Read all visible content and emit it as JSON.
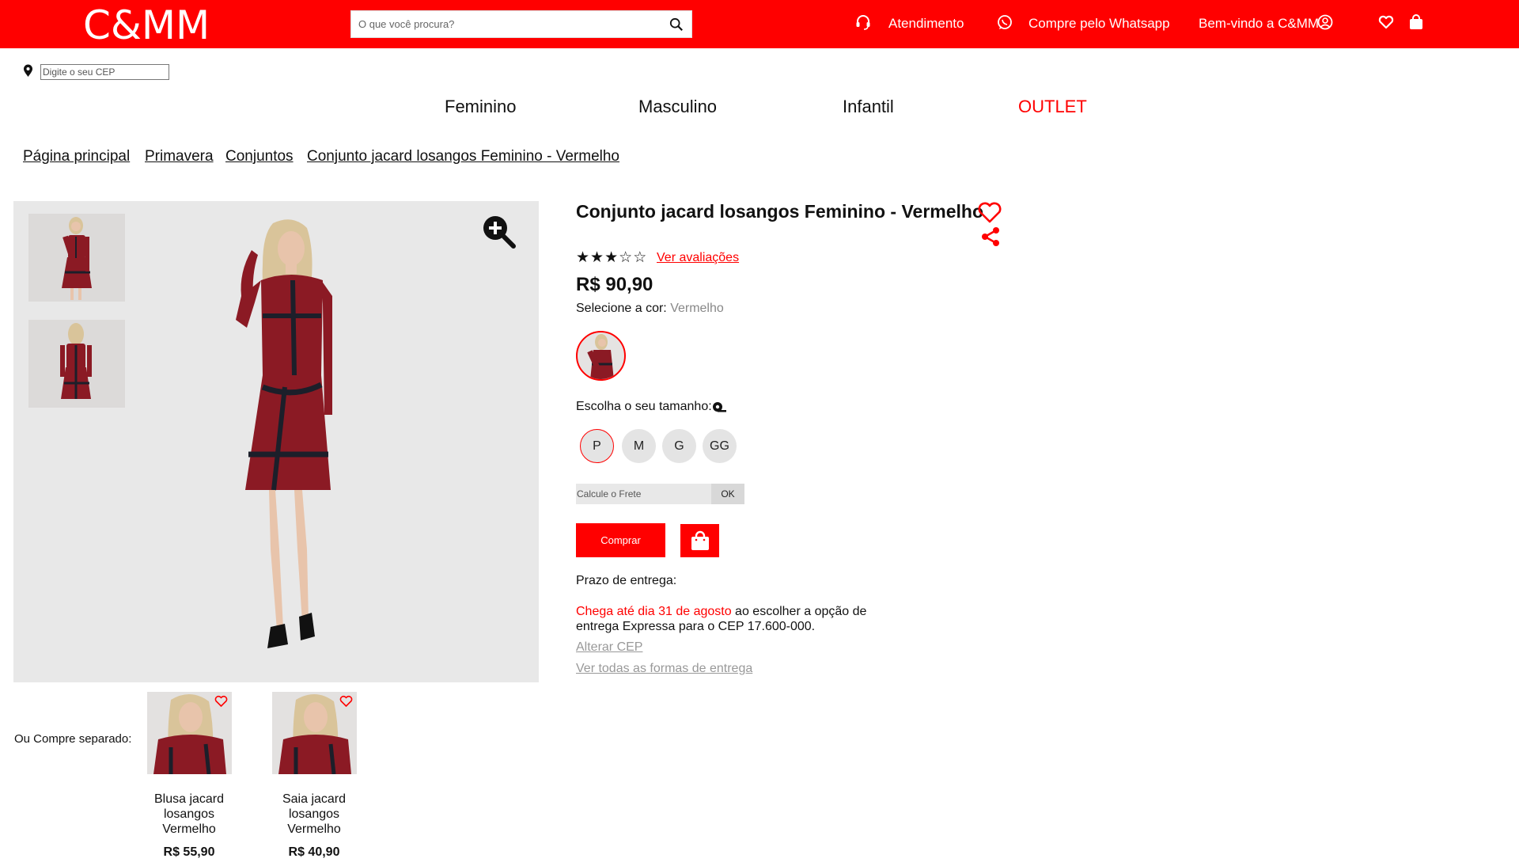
{
  "header": {
    "logo": "C&MM",
    "search_placeholder": "O que você procura?",
    "atendimento": "Atendimento",
    "whatsapp": "Compre pelo Whatsapp",
    "welcome": "Bem-vindo a C&MM"
  },
  "cep": {
    "placeholder": "Digite o seu CEP"
  },
  "nav": {
    "feminino": "Feminino",
    "masculino": "Masculino",
    "infantil": "Infantil",
    "outlet": "OUTLET"
  },
  "breadcrumb": [
    "Página principal",
    "Primavera",
    "Conjuntos",
    "Conjunto jacard losangos Feminino - Vermelho"
  ],
  "product": {
    "title": "Conjunto jacard losangos Feminino - Vermelho",
    "rating": 3,
    "rating_max": 5,
    "reviews_link": "Ver avaliações",
    "price": "R$ 90,90",
    "color_label": "Selecione a cor:",
    "color_value": "Vermelho",
    "size_label": "Escolha o seu tamanho:",
    "sizes": [
      "P",
      "M",
      "G",
      "GG"
    ],
    "selected_size": "P",
    "frete_placeholder": "Calcule o Frete",
    "ok_label": "OK",
    "buy_label": "Comprar",
    "prazo_label": "Prazo de entrega:",
    "delivery_red": "Chega até dia 31 de agosto",
    "delivery_rest": " ao escolher a opção de entrega Expressa para o CEP 17.600-000.",
    "alterar_cep": "Alterar CEP",
    "ver_formas": "Ver todas as formas de entrega"
  },
  "separate": {
    "label": "Ou Compre separado:",
    "items": [
      {
        "name": "Blusa jacard losangos Vermelho",
        "price": "R$ 55,90"
      },
      {
        "name": "Saia jacard losangos Vermelho",
        "price": "R$ 40,90"
      }
    ]
  },
  "colors": {
    "brand": "#ff0000",
    "dress": "#8b1a24",
    "dress_trim": "#1c1f2a",
    "hair": "#d9c49a",
    "skin": "#e8c4ab"
  }
}
